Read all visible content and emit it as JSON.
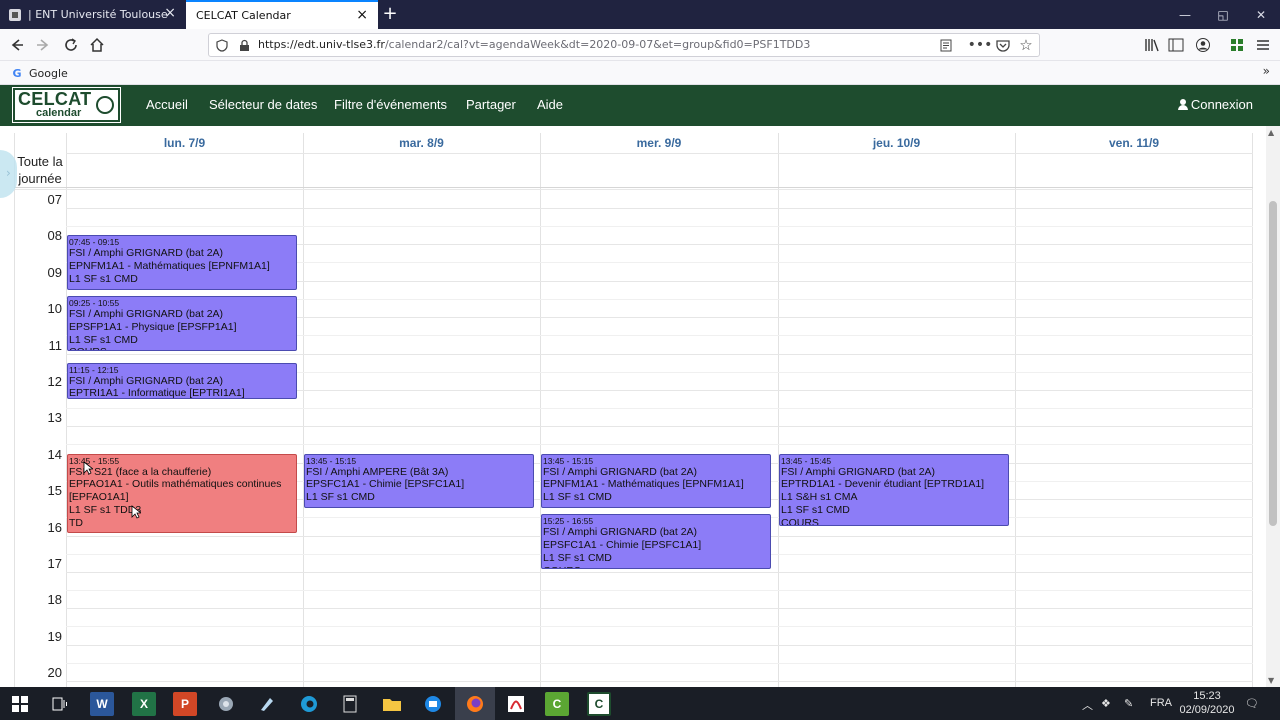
{
  "browser": {
    "tabs": [
      {
        "title": "| ENT Université Toulouse III - P",
        "active": false
      },
      {
        "title": "CELCAT Calendar",
        "active": true
      }
    ],
    "url_host": "https://edt.univ-tlse3.fr",
    "url_path": "/calendar2/cal?vt=agendaWeek&dt=2020-09-07&et=group&fid0=PSF1TDD3",
    "bookmarks": [
      "Google"
    ],
    "icons": [
      "back-icon",
      "forward-icon",
      "reload-icon",
      "home-icon",
      "shield-icon",
      "lock-icon",
      "reader-icon",
      "more-icon",
      "pocket-icon",
      "star-icon",
      "library-icon",
      "sidebar-icon",
      "account-icon",
      "extensions-icon",
      "menu-icon"
    ]
  },
  "celcat": {
    "logo_top": "CELCAT",
    "logo_bottom": "calendar",
    "menu": [
      "Accueil",
      "Sélecteur de dates",
      "Filtre d'événements",
      "Partager",
      "Aide"
    ],
    "login": "Connexion",
    "brand_color": "#1e4c2e"
  },
  "calendar": {
    "allday_label": "Toute la journée",
    "days": [
      "lun. 7/9",
      "mar. 8/9",
      "mer. 9/9",
      "jeu. 10/9",
      "ven. 11/9"
    ],
    "hours": [
      "07",
      "08",
      "09",
      "10",
      "11",
      "12",
      "13",
      "14",
      "15",
      "16",
      "17",
      "18",
      "19",
      "20"
    ],
    "events": [
      {
        "day": 0,
        "start": "07:45",
        "end": "09:15",
        "time": "07:45 - 09:15",
        "color": "purple",
        "lines": [
          "FSI / Amphi GRIGNARD (bat 2A)",
          "EPNFM1A1 - Mathématiques [EPNFM1A1]",
          "L1 SF s1 CMD"
        ]
      },
      {
        "day": 0,
        "start": "09:25",
        "end": "10:55",
        "time": "09:25 - 10:55",
        "color": "purple",
        "lines": [
          "FSI / Amphi GRIGNARD (bat 2A)",
          "EPSFP1A1 - Physique [EPSFP1A1]",
          "L1 SF s1 CMD",
          "COURS"
        ]
      },
      {
        "day": 0,
        "start": "11:15",
        "end": "12:15",
        "time": "11:15 - 12:15",
        "color": "purple",
        "lines": [
          "FSI / Amphi GRIGNARD (bat 2A)",
          "EPTRI1A1 - Informatique [EPTRI1A1]"
        ]
      },
      {
        "day": 0,
        "start": "13:45",
        "end": "15:55",
        "time": "13:45 - 15:55",
        "color": "red",
        "lines": [
          "FSI / S21 (face a la chaufferie)",
          "EPFAO1A1 - Outils mathématiques continues [EPFAO1A1]",
          "L1 SF s1 TDD3",
          "TD"
        ]
      },
      {
        "day": 1,
        "start": "13:45",
        "end": "15:15",
        "time": "13:45 - 15:15",
        "color": "purple",
        "lines": [
          "FSI / Amphi AMPERE (Bât 3A)",
          "EPSFC1A1 - Chimie [EPSFC1A1]",
          "L1 SF s1 CMD"
        ]
      },
      {
        "day": 2,
        "start": "13:45",
        "end": "15:15",
        "time": "13:45 - 15:15",
        "color": "purple",
        "lines": [
          "FSI / Amphi GRIGNARD (bat 2A)",
          "EPNFM1A1 - Mathématiques [EPNFM1A1]",
          "L1 SF s1 CMD"
        ]
      },
      {
        "day": 2,
        "start": "15:25",
        "end": "16:55",
        "time": "15:25 - 16:55",
        "color": "purple",
        "lines": [
          "FSI / Amphi GRIGNARD (bat 2A)",
          "EPSFC1A1 - Chimie [EPSFC1A1]",
          "L1 SF s1 CMD",
          "COURS"
        ]
      },
      {
        "day": 3,
        "start": "13:45",
        "end": "15:45",
        "time": "13:45 - 15:45",
        "color": "purple",
        "lines": [
          "FSI / Amphi GRIGNARD (bat 2A)",
          "EPTRD1A1 - Devenir étudiant [EPTRD1A1]",
          "L1 S&H s1 CMA",
          "L1 SF s1 CMD",
          "COURS"
        ]
      }
    ],
    "event_colors": {
      "purple": "#8c7cf7",
      "red": "#f07f80"
    }
  },
  "taskbar": {
    "apps": [
      "start-icon",
      "task-view-icon",
      "word-icon",
      "excel-icon",
      "powerpoint-icon",
      "app-icon",
      "notepad-icon",
      "edge-icon",
      "calculator-icon",
      "file-explorer-icon",
      "outlook-icon",
      "firefox-icon",
      "acrobat-icon",
      "camtasia-icon",
      "celcat-app-icon"
    ],
    "language": "FRA",
    "time": "15:23",
    "date": "02/09/2020"
  }
}
